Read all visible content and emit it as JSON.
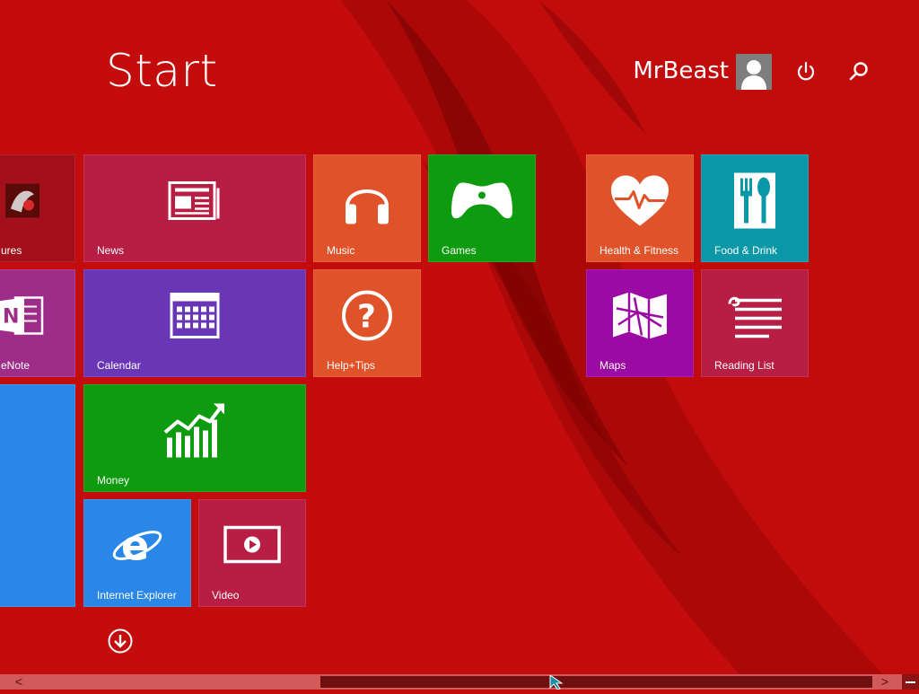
{
  "header": {
    "title": "Start",
    "user_name": "MrBeast"
  },
  "tiles": {
    "pictures": {
      "label": "ures",
      "color": "#a4101a"
    },
    "news": {
      "label": "News",
      "color": "#b81d43"
    },
    "music": {
      "label": "Music",
      "color": "#e0532a"
    },
    "games": {
      "label": "Games",
      "color": "#0f9b0f"
    },
    "health": {
      "label": "Health & Fitness",
      "color": "#e0532a"
    },
    "food": {
      "label": "Food & Drink",
      "color": "#0a98a8"
    },
    "onenote": {
      "label": "eNote",
      "color": "#9e2d8a"
    },
    "calendar": {
      "label": "Calendar",
      "color": "#6936b6"
    },
    "help": {
      "label": "Help+Tips",
      "color": "#e0532a"
    },
    "maps": {
      "label": "Maps",
      "color": "#9b0ba3"
    },
    "reading": {
      "label": "Reading List",
      "color": "#b81d43"
    },
    "desktop": {
      "color": "#2a87e8"
    },
    "money": {
      "label": "Money",
      "color": "#0f9b0f"
    },
    "ie": {
      "label": "Internet Explorer",
      "color": "#2a87e8"
    },
    "video": {
      "label": "Video",
      "color": "#b81d43"
    }
  },
  "icons": {
    "avatar": "user-avatar-icon",
    "power": "power-icon",
    "search": "search-icon",
    "apps_view": "down-arrow-circle-icon"
  },
  "scrollbar": {
    "left_arrow": "<",
    "right_arrow": ">"
  },
  "colors": {
    "background": "#c20b0b",
    "accent_dark": "#6f1010"
  }
}
